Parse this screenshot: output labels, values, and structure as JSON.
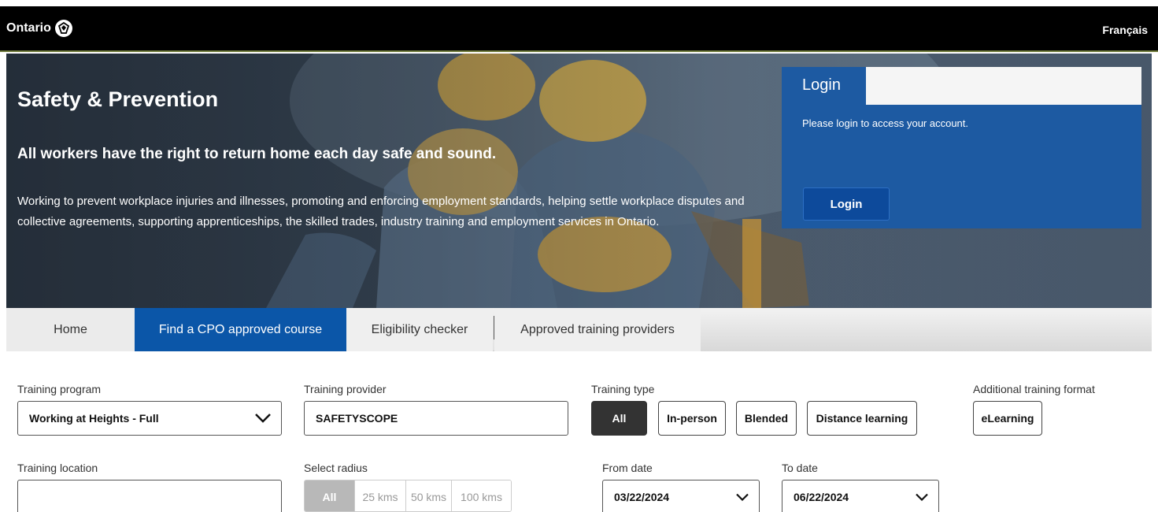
{
  "header": {
    "logo_text": "Ontario",
    "language_link": "Français"
  },
  "hero": {
    "title": "Safety & Prevention",
    "subtitle": "All workers have the right to return home each day safe and sound.",
    "description": "Working to prevent workplace injuries and illnesses, promoting and enforcing employment standards, helping settle workplace disputes and collective agreements, supporting apprenticeships, the skilled trades, industry training and employment services in Ontario."
  },
  "login": {
    "tab_label": "Login",
    "message": "Please login to access your account.",
    "button_label": "Login"
  },
  "nav": {
    "tabs": [
      {
        "label": "Home",
        "active": false
      },
      {
        "label": "Find a CPO approved course",
        "active": true
      },
      {
        "label": "Eligibility checker",
        "active": false
      },
      {
        "label": "Approved training providers",
        "active": false
      }
    ]
  },
  "filters": {
    "training_program": {
      "label": "Training program",
      "value": "Working at Heights - Full"
    },
    "training_provider": {
      "label": "Training provider",
      "value": "SAFETYSCOPE"
    },
    "training_type": {
      "label": "Training type",
      "options": [
        "All",
        "In-person",
        "Blended",
        "Distance learning"
      ],
      "selected": "All"
    },
    "additional_format": {
      "label": "Additional training format",
      "options": [
        "eLearning"
      ]
    },
    "training_location": {
      "label": "Training location",
      "value": ""
    },
    "radius": {
      "label": "Select radius",
      "options": [
        "All",
        "25 kms",
        "50 kms",
        "100 kms"
      ],
      "selected": "All"
    },
    "from_date": {
      "label": "From date",
      "value": "03/22/2024"
    },
    "to_date": {
      "label": "To date",
      "value": "06/22/2024"
    }
  },
  "colors": {
    "top_bar": "#000000",
    "login_panel": "#1d5aa2",
    "active_tab": "#0b56a8",
    "active_pill": "#333333"
  }
}
